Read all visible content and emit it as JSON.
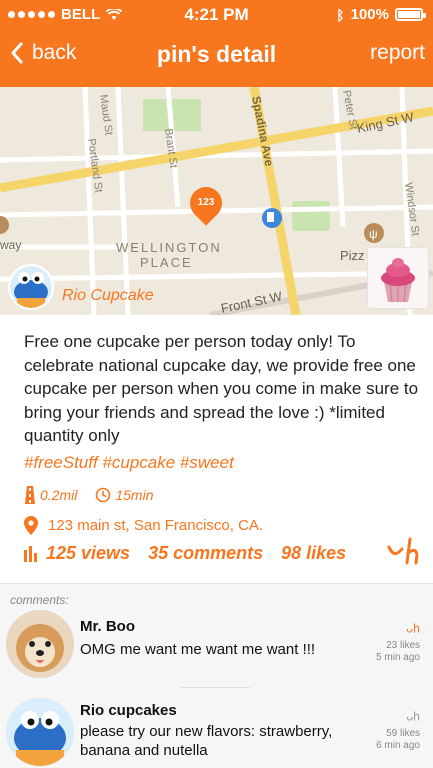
{
  "status_bar": {
    "carrier": "BELL",
    "time": "4:21 PM",
    "battery": "100%",
    "battery_level": 1.0
  },
  "nav": {
    "back_label": "back",
    "title": "pin's detail",
    "report_label": "report"
  },
  "map": {
    "streets": [
      "Maud St",
      "Brant St",
      "Portland St",
      "Spadina Ave",
      "Peter St",
      "King St W",
      "Windsor St",
      "Front St W"
    ],
    "area_label_1": "WELLINGTON",
    "area_label_2": "PLACE",
    "poi_label": "Pizz",
    "side_label": "way",
    "pin_number": "123",
    "place_name": "Rio Cupcake"
  },
  "post": {
    "description": "Free one cupcake per person today only! To celebrate national cupcake day, we provide free one cupcake per person when you come in make sure to bring your friends and spread the love :) *limited quantity only",
    "tags": "#freeStuff #cupcake #sweet",
    "distance": "0.2mil",
    "time": "15min",
    "address": "123 main st, San Francisco, CA.",
    "views": "125 views",
    "comments": "35 comments",
    "likes": "98 likes",
    "like_icon": "ᵕʰ"
  },
  "comments_section": {
    "label": "comments:",
    "items": [
      {
        "name": "Mr. Boo",
        "text": "OMG me want me want me want !!!",
        "likes": "23 likes",
        "ago": "5 min ago"
      },
      {
        "name": "Rio cupcakes",
        "text": "please try our new flavors: strawberry, banana and nutella",
        "likes": "59 likes",
        "ago": "6 min ago"
      }
    ]
  },
  "colors": {
    "accent": "#f7761e",
    "map_bg": "#efe9dd",
    "road_yellow": "#f5d46a",
    "park_green": "#c9e3b1"
  }
}
